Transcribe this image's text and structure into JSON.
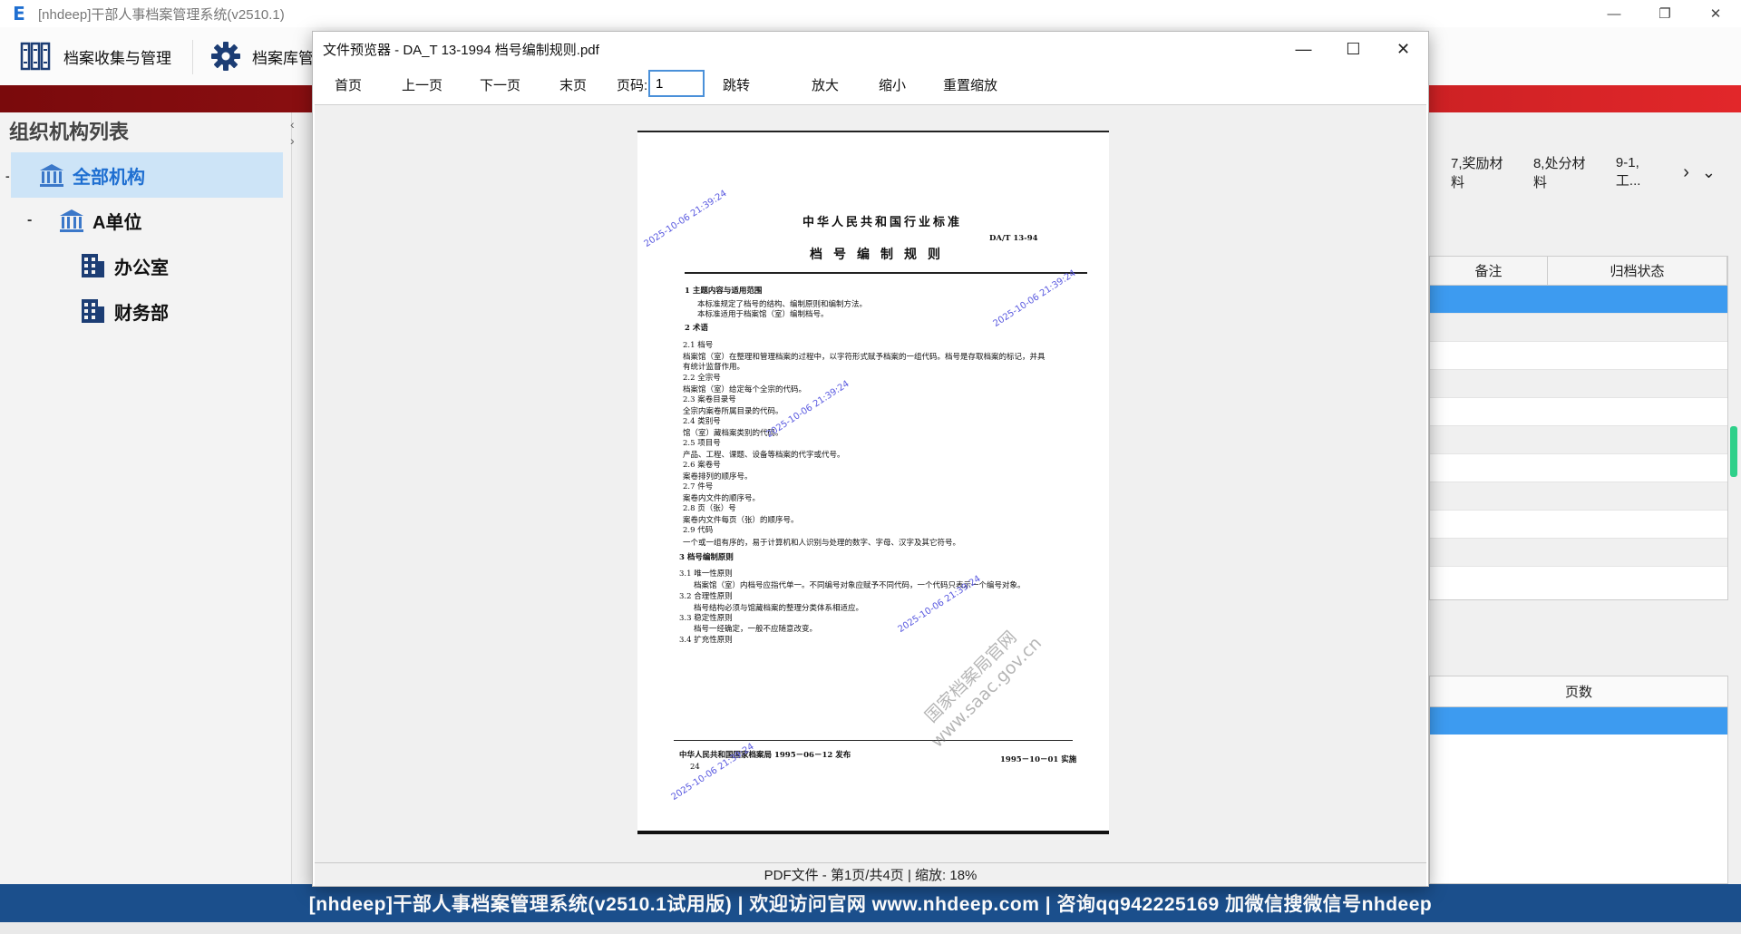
{
  "app": {
    "logo": "E",
    "title": "[nhdeep]干部人事档案管理系统(v2510.1)",
    "window_buttons": [
      "—",
      "❐",
      "✕"
    ]
  },
  "toolbar": {
    "items": [
      {
        "icon": "archive-shelves-icon",
        "label": "档案收集与管理"
      },
      {
        "icon": "gear-icon",
        "label": "档案库管"
      }
    ]
  },
  "sidebar": {
    "title": "组织机构列表",
    "collapse_arrows": [
      "‹",
      "›"
    ],
    "items": [
      {
        "label": "全部机构",
        "icon": "institution-icon",
        "selected": true
      },
      {
        "label": "A单位",
        "icon": "institution-icon",
        "prefix": "-"
      },
      {
        "label": "办公室",
        "icon": "building-icon"
      },
      {
        "label": "财务部",
        "icon": "building-icon"
      }
    ]
  },
  "right": {
    "tabs": [
      "7,奖励材料",
      "8,处分材料",
      "9-1,工..."
    ],
    "tab_arrows": [
      "›",
      "⌄"
    ],
    "grid1": {
      "columns": [
        "备注",
        "归档状态"
      ]
    },
    "grid2": {
      "columns": [
        "页数"
      ]
    }
  },
  "dialog": {
    "title": "文件预览器 - DA_T 13-1994 档号编制规则.pdf",
    "window_buttons": [
      "—",
      "☐",
      "✕"
    ],
    "buttons": {
      "first": "首页",
      "prev": "上一页",
      "next": "下一页",
      "last": "末页",
      "page_label": "页码:",
      "page_value": "1",
      "jump": "跳转",
      "zoom_in": "放大",
      "zoom_out": "缩小",
      "reset": "重置缩放"
    },
    "status": "PDF文件 - 第1页/共4页 | 缩放: 18%"
  },
  "pdf": {
    "header": "中华人民共和国行业标准",
    "code": "DA/T 13-94",
    "doc_title": "档号编制规则",
    "sections": [
      {
        "t": "1  主题内容与适用范围",
        "bold": true
      },
      {
        "t": "本标准规定了档号的结构、编制原则和编制方法。"
      },
      {
        "t": "本标准适用于档案馆（室）编制档号。"
      },
      {
        "t": "2  术语",
        "bold": true
      },
      {
        "t": "2.1  档号"
      },
      {
        "t": "档案馆（室）在整理和管理档案的过程中，以字符形式赋予档案的一组代码。档号是存取档案的标记，并具"
      },
      {
        "t": "有统计监督作用。"
      },
      {
        "t": "2.2  全宗号"
      },
      {
        "t": "档案馆（室）给定每个全宗的代码。"
      },
      {
        "t": "2.3  案卷目录号"
      },
      {
        "t": "全宗内案卷所属目录的代码。"
      },
      {
        "t": "2.4  类别号"
      },
      {
        "t": "馆（室）藏档案类别的代码。"
      },
      {
        "t": "2.5  项目号"
      },
      {
        "t": "产品、工程、课题、设备等档案的代字或代号。"
      },
      {
        "t": "2.6  案卷号"
      },
      {
        "t": "案卷排列的顺序号。"
      },
      {
        "t": "2.7  件号"
      },
      {
        "t": "案卷内文件的顺序号。"
      },
      {
        "t": "2.8  页（张）号"
      },
      {
        "t": "案卷内文件每页（张）的顺序号。"
      },
      {
        "t": "2.9  代码"
      },
      {
        "t": "一个或一组有序的，易于计算机和人识别与处理的数字、字母、汉字及其它符号。"
      },
      {
        "t": "3  档号编制原则",
        "bold": true
      },
      {
        "t": "3.1  唯一性原则"
      },
      {
        "t": "档案馆（室）内档号应指代单一。不同编号对象应赋予不同代码，一个代码只表示一个编号对象。"
      },
      {
        "t": "3.2  合理性原则"
      },
      {
        "t": "档号结构必须与馆藏档案的整理分类体系相适应。"
      },
      {
        "t": "3.3  稳定性原则"
      },
      {
        "t": "档号一经确定，一般不应随意改变。"
      },
      {
        "t": "3.4  扩充性原则"
      }
    ],
    "footer_left": "中华人民共和国国家档案局 1995－06－12 发布",
    "footer_right": "1995－10－01 实施",
    "page_num": "24",
    "watermark_time": "2025-10-06 21:39:24",
    "watermark_site": "国家档案局官网\nwww.saac.gov.cn"
  },
  "footer": {
    "text": "[nhdeep]干部人事档案管理系统(v2510.1试用版) | 欢迎访问官网 www.nhdeep.com | 咨询qq942225169 加微信搜微信号nhdeep"
  },
  "colors": {
    "accent": "#1f6fd1",
    "status_bar": "#1b4f8c",
    "red_band": "#e2272a",
    "selection": "#3d9bf0",
    "watermark": "#5a5ae0"
  }
}
